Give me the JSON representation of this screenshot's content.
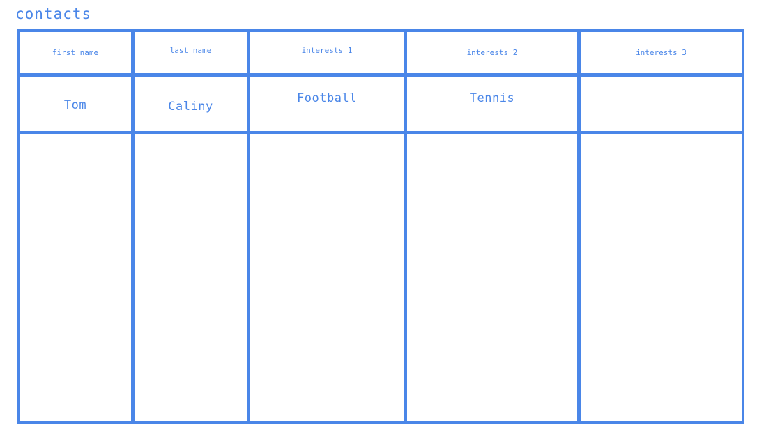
{
  "page": {
    "title": "contacts"
  },
  "table": {
    "columns": [
      {
        "header": "first name"
      },
      {
        "header": "last name"
      },
      {
        "header": "interests 1"
      },
      {
        "header": "interests 2"
      },
      {
        "header": "interests 3"
      }
    ],
    "rows": [
      [
        "Tom",
        "Caliny",
        "Football",
        "Tennis",
        ""
      ]
    ]
  },
  "colors": {
    "accent": "#4a86e8",
    "background": "#ffffff"
  }
}
